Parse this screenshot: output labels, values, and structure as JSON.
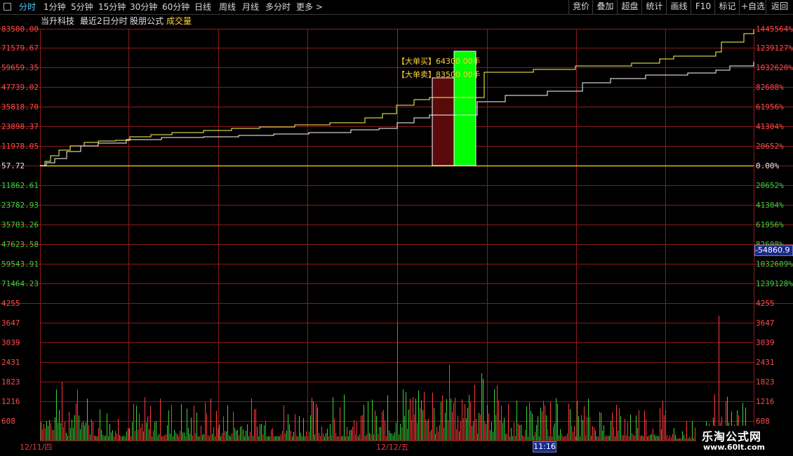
{
  "toolbar": {
    "left_items": [
      "分时",
      "1分钟",
      "5分钟",
      "15分钟",
      "30分钟",
      "60分钟",
      "日线",
      "周线",
      "月线",
      "多分时",
      "更多 >"
    ],
    "active_index": 0,
    "right_items": [
      "竞价",
      "叠加",
      "超盘",
      "统计",
      "画线",
      "F10",
      "标记",
      "+自选",
      "返回"
    ]
  },
  "title": {
    "stock_name": "当升科技",
    "period": "最近2日分时",
    "formula": "股朋公式",
    "indicator": "成交量"
  },
  "price_axis": {
    "left_up": [
      "83500.00",
      "71579.67",
      "59659.35",
      "47739.02",
      "35818.70",
      "23898.37",
      "11978.05"
    ],
    "left_mid": "57.72",
    "left_down": [
      "11862.61",
      "23782.93",
      "35703.26",
      "47623.58",
      "59543.91",
      "71464.23"
    ],
    "right_up": [
      "1445564%",
      "1239127%",
      "1032620%",
      "82608%",
      "61956%",
      "41304%",
      "20652%"
    ],
    "right_mid": "0.00%",
    "right_down": [
      "20652%",
      "41304%",
      "61956%",
      "82608%",
      "1032609%",
      "1239128%"
    ]
  },
  "volume_axis": {
    "labels": [
      "4255",
      "3647",
      "3039",
      "2431",
      "1823",
      "1216",
      "608"
    ]
  },
  "annotations": {
    "sell_label": "【大单买】",
    "sell_value": "64300.00手",
    "buy_label": "【大单卖】",
    "buy_value": "83500.00手"
  },
  "dates": {
    "day1": "12/11/四",
    "day2": "12/12/五",
    "cursor_time": "11:16",
    "cursor_value": "-54860.9"
  },
  "watermark": {
    "title": "乐淘公式网",
    "url": "www.60lt.com"
  },
  "colors": {
    "grid": "#8b1a1a",
    "price_line": "#ffffff",
    "avg_line": "#ffff5a",
    "base_line": "#ffd700",
    "up_bar": "#ff3b3b",
    "down_bar": "#3bd23b",
    "big_sell_block": "#5a0a0a",
    "big_buy_block": "#00ff00"
  }
}
